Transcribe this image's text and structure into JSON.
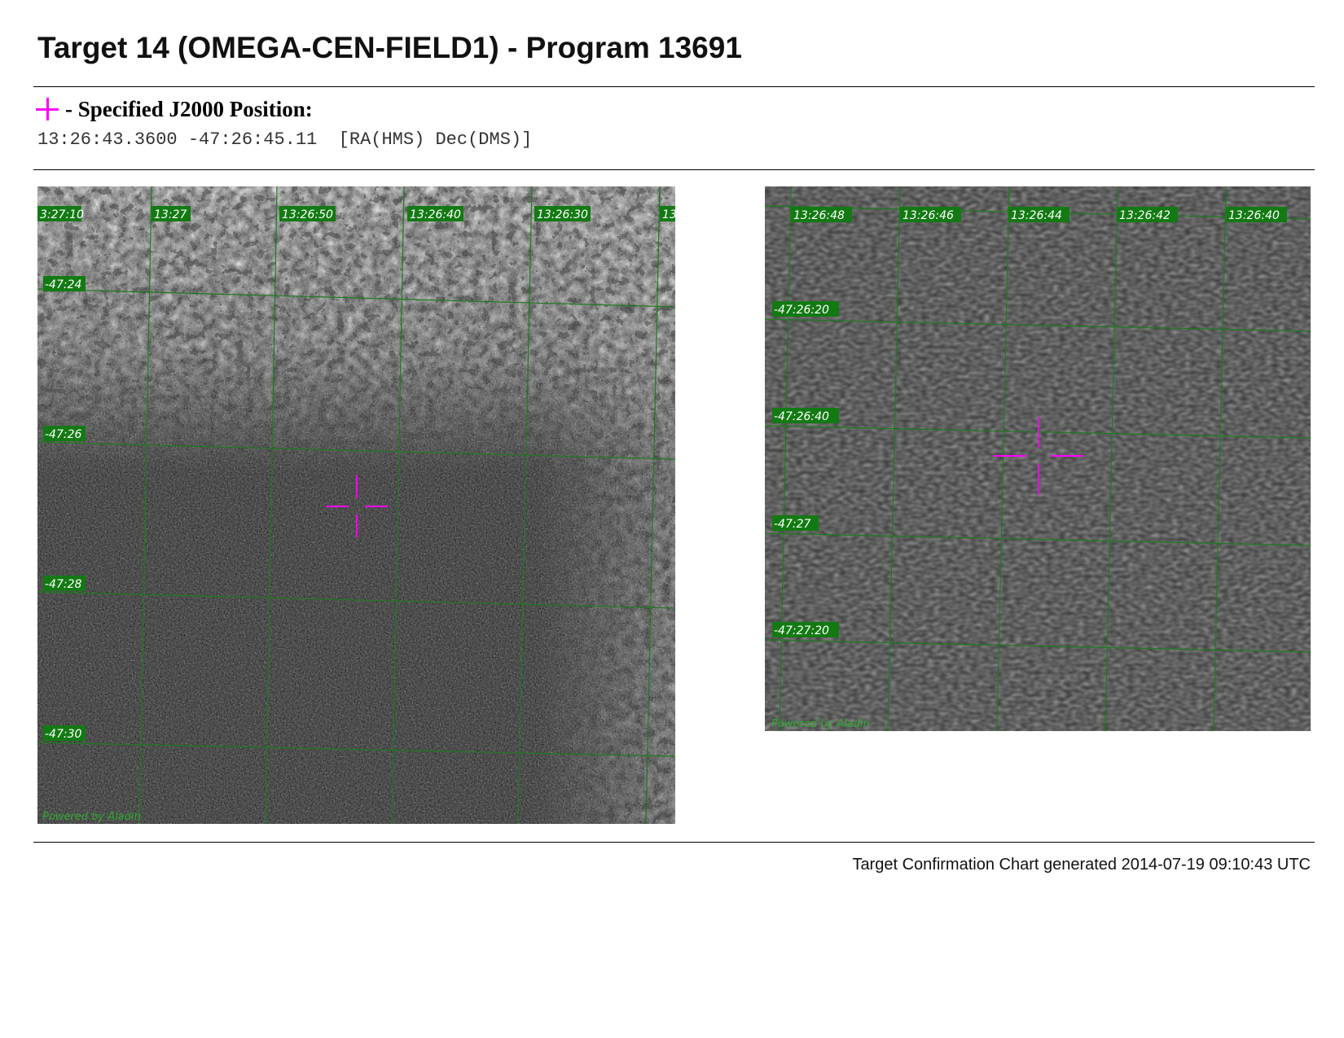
{
  "page": {
    "title": "Target 14 (OMEGA-CEN-FIELD1) - Program 13691",
    "position_label": "- Specified J2000 Position:",
    "marker_icon": "magenta-crosshair-icon",
    "coordinates": "13:26:43.3600 -47:26:45.11  [RA(HMS) Dec(DMS)]",
    "footer": "Target Confirmation Chart generated 2014-07-19 09:10:43 UTC"
  },
  "colors": {
    "marker": "#ff00ff",
    "grid": "#1f7a1f",
    "label_bg": "#137a13",
    "label_text": "#ffffff",
    "credit": "#2fa82f"
  },
  "charts": {
    "wide": {
      "ra_labels": [
        "3:27:10",
        "13:27",
        "13:26:50",
        "13:26:40",
        "13:26:30",
        "13"
      ],
      "dec_labels": [
        "-47:24",
        "-47:26",
        "-47:28",
        "-47:30"
      ],
      "credit": "Powered by Aladin"
    },
    "zoom": {
      "ra_labels": [
        "13:26:48",
        "13:26:46",
        "13:26:44",
        "13:26:42",
        "13:26:40"
      ],
      "dec_labels": [
        "-47:26:20",
        "-47:26:40",
        "-47:27",
        "-47:27:20"
      ],
      "credit": "Powered by Aladin"
    }
  }
}
